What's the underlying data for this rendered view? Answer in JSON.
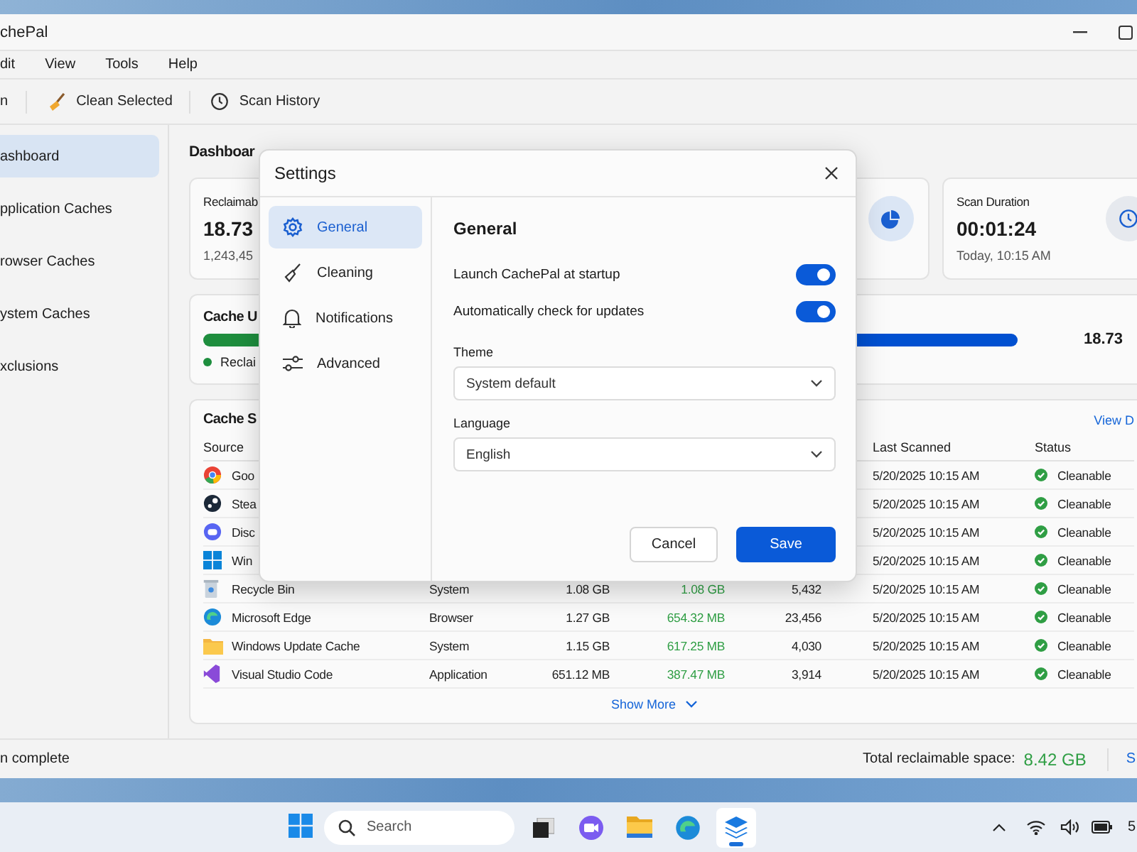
{
  "window": {
    "title": "chePal"
  },
  "menu": [
    "dit",
    "View",
    "Tools",
    "Help"
  ],
  "toolbar": [
    {
      "label": "n",
      "kind": "plain"
    },
    {
      "label": "Clean Selected",
      "kind": "broom"
    },
    {
      "label": "Scan History",
      "kind": "clock"
    }
  ],
  "sidebar": {
    "items": [
      {
        "label": "ashboard",
        "selected": true
      },
      {
        "label": "pplication Caches",
        "selected": false
      },
      {
        "label": "rowser Caches",
        "selected": false
      },
      {
        "label": "ystem Caches",
        "selected": false
      },
      {
        "label": "xclusions",
        "selected": false
      }
    ]
  },
  "page_title": "Dashboar",
  "cards": [
    {
      "label": "Reclaimab",
      "value": "18.73",
      "sub": "1,243,45",
      "kind": "plain"
    },
    {
      "kind": "pie"
    },
    {
      "label": "Scan Duration",
      "value": "00:01:24",
      "sub": "Today, 10:15 AM",
      "kind": "clock"
    }
  ],
  "usage": {
    "title": "Cache U",
    "legend": "Reclai",
    "total": "18.73"
  },
  "sources": {
    "title": "Cache S",
    "link": "View D",
    "columns": {
      "source": "Source",
      "last_scanned": "Last Scanned",
      "status": "Status"
    },
    "rows": [
      {
        "kind": "ring",
        "source": "Goo",
        "last_scanned": "5/20/2025 10:15 AM",
        "status": "Cleanable"
      },
      {
        "kind": "dark",
        "source": "Stea",
        "last_scanned": "5/20/2025 10:15 AM",
        "status": "Cleanable"
      },
      {
        "kind": "chat",
        "source": "Disc",
        "last_scanned": "5/20/2025 10:15 AM",
        "status": "Cleanable"
      },
      {
        "kind": "squares",
        "source": "Win",
        "last_scanned": "5/20/2025 10:15 AM",
        "status": "Cleanable"
      },
      {
        "kind": "bin",
        "source": "Recycle Bin",
        "category": "System",
        "size": "1.08 GB",
        "reclaimable": "1.08 GB",
        "files": "5,432",
        "last_scanned": "5/20/2025 10:15 AM",
        "status": "Cleanable"
      },
      {
        "kind": "swirl",
        "source": "Microsoft Edge",
        "category": "Browser",
        "size": "1.27 GB",
        "reclaimable": "654.32 MB",
        "files": "23,456",
        "last_scanned": "5/20/2025 10:15 AM",
        "status": "Cleanable"
      },
      {
        "kind": "folder",
        "source": "Windows Update Cache",
        "category": "System",
        "size": "1.15 GB",
        "reclaimable": "617.25 MB",
        "files": "4,030",
        "last_scanned": "5/20/2025 10:15 AM",
        "status": "Cleanable"
      },
      {
        "kind": "ribbon",
        "source": "Visual Studio Code",
        "category": "Application",
        "size": "651.12 MB",
        "reclaimable": "387.47 MB",
        "files": "3,914",
        "last_scanned": "5/20/2025 10:15 AM",
        "status": "Cleanable"
      }
    ],
    "show_more": "Show More"
  },
  "status_bar": {
    "left": "n complete",
    "total_label": "Total reclaimable space:",
    "total_value": "8.42 GB",
    "link": "S"
  },
  "dialog": {
    "title": "Settings",
    "nav": [
      {
        "label": "General",
        "kind": "gear",
        "selected": true
      },
      {
        "label": "Cleaning",
        "kind": "broom",
        "selected": false
      },
      {
        "label": "Notifications",
        "kind": "bell",
        "selected": false
      },
      {
        "label": "Advanced",
        "kind": "sliders",
        "selected": false
      }
    ],
    "heading": "General",
    "toggles": [
      {
        "label": "Launch CachePal at startup",
        "on": true
      },
      {
        "label": "Automatically check for updates",
        "on": true
      }
    ],
    "selects": [
      {
        "label": "Theme",
        "value": "System default"
      },
      {
        "label": "Language",
        "value": "English"
      }
    ],
    "buttons": [
      {
        "label": "Cancel",
        "kind": "secondary"
      },
      {
        "label": "Save",
        "kind": "primary"
      }
    ]
  },
  "taskbar": {
    "search_placeholder": "Search",
    "apps": [
      {
        "kind": "taskview",
        "active": false
      },
      {
        "kind": "camera",
        "active": false
      },
      {
        "kind": "folder",
        "active": false
      },
      {
        "kind": "swirl",
        "active": false
      },
      {
        "kind": "layers",
        "active": true
      }
    ],
    "clock": "5"
  }
}
